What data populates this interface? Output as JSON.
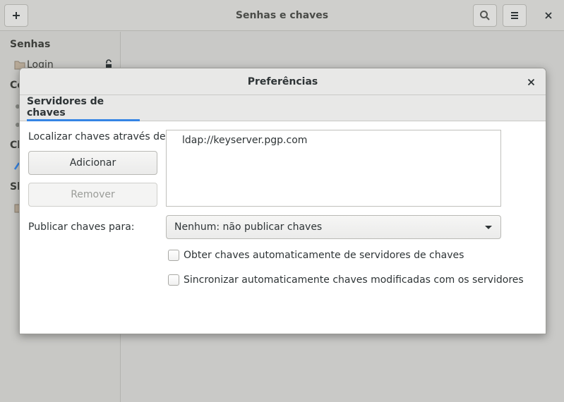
{
  "app": {
    "title": "Senhas e chaves",
    "add_icon": "plus-icon",
    "search_icon": "search-icon",
    "menu_icon": "hamburger-menu-icon",
    "close_icon": "close-icon"
  },
  "sidebar": {
    "heading_passwords": "Senhas",
    "login_label": "Login",
    "heading_c1": "Ce",
    "heading_c2": "Ch",
    "heading_s": "Sh"
  },
  "dialog": {
    "title": "Preferências",
    "tab_label": "Servidores de chaves",
    "find_keys_label": "Localizar chaves através de:",
    "add_button": "Adicionar",
    "remove_button": "Remover",
    "keyservers": [
      "ldap://keyserver.pgp.com"
    ],
    "publish_label": "Publicar chaves para:",
    "publish_selected": "Nenhum: não publicar chaves",
    "auto_retrieve_label": "Obter chaves automaticamente de servidores de chaves",
    "auto_sync_label": "Sincronizar automaticamente chaves modificadas com os servidores",
    "auto_retrieve_checked": false,
    "auto_sync_checked": false
  },
  "colors": {
    "accent": "#3584e4",
    "dialog_bg": "#ffffff",
    "backdrop": "#c9c9c7"
  }
}
